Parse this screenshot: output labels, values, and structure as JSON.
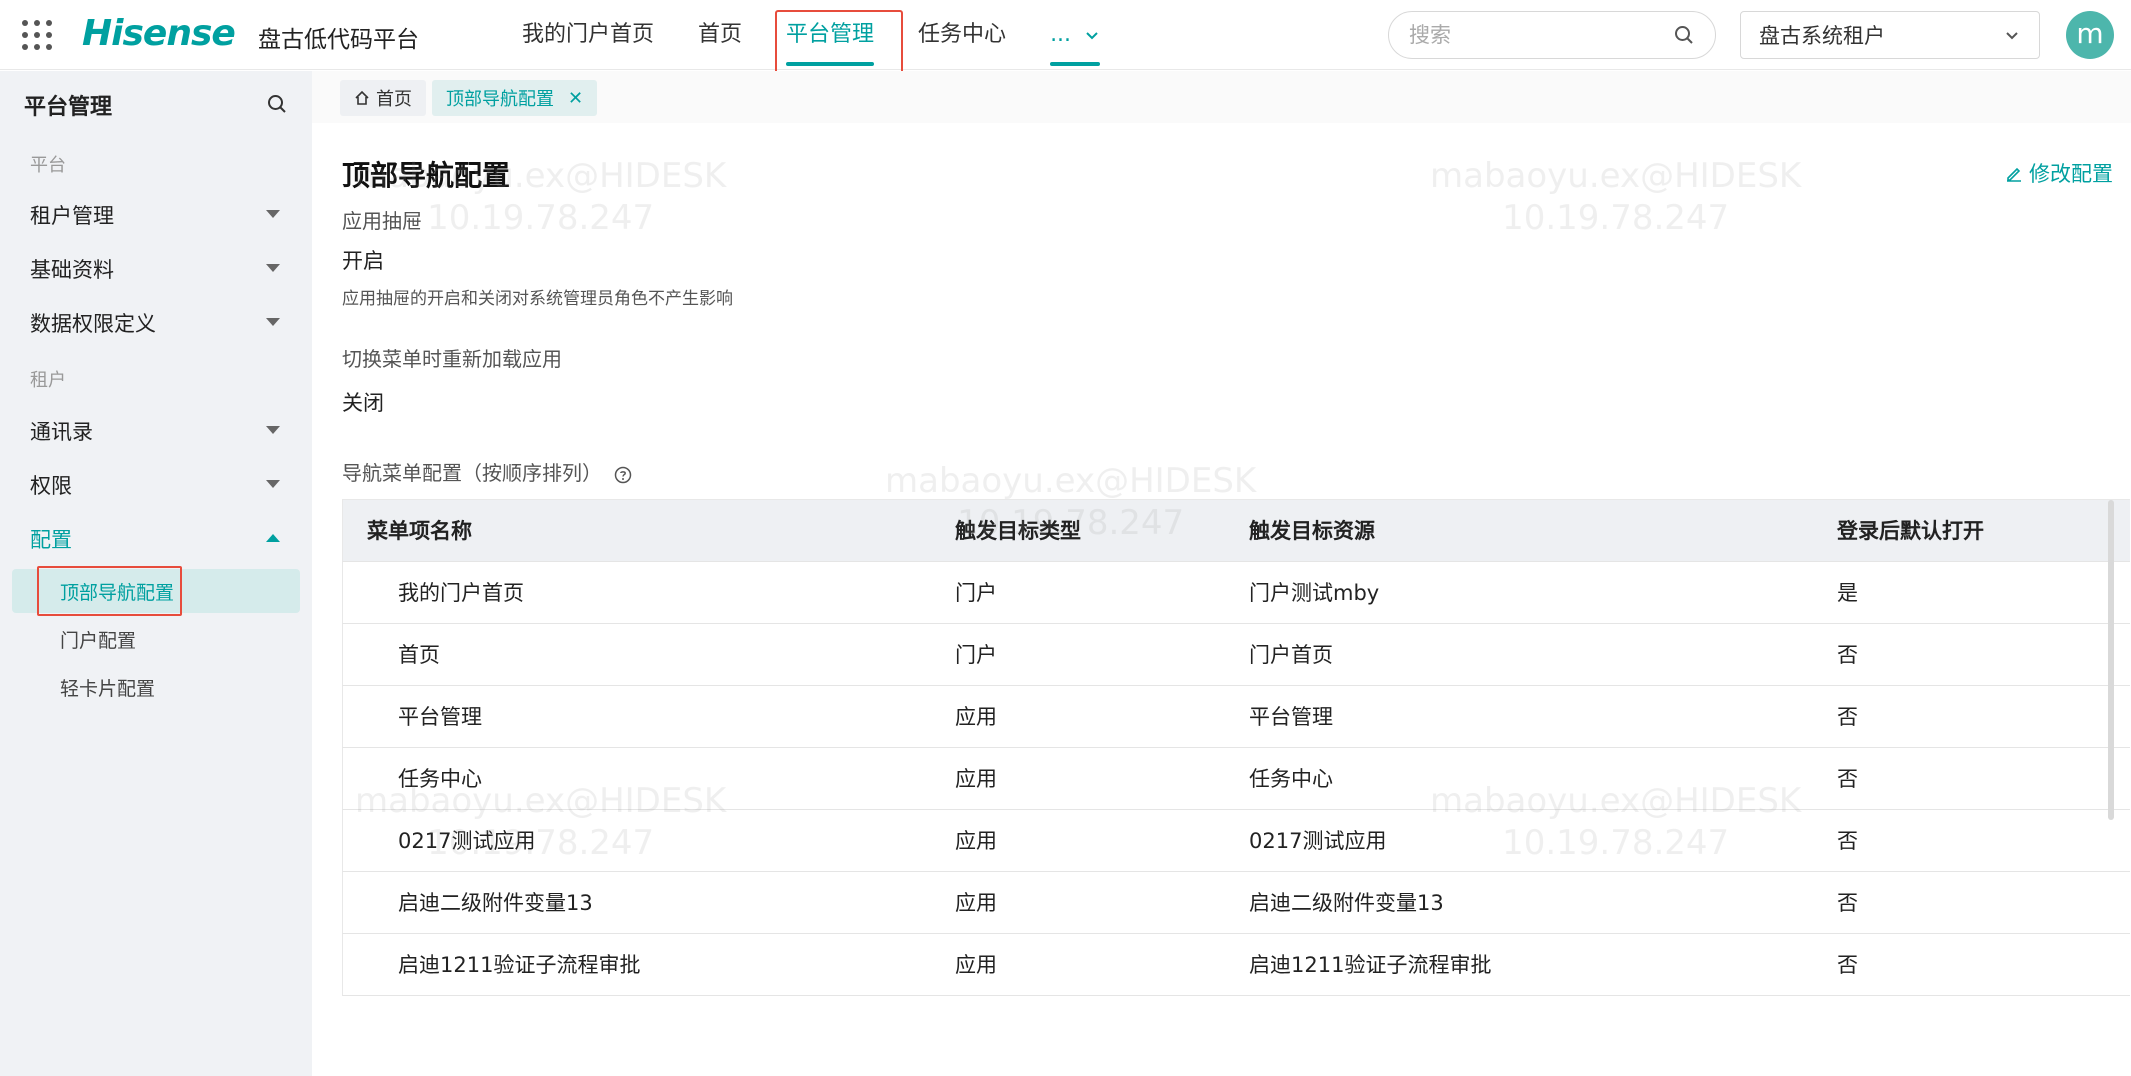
{
  "header": {
    "logo": "Hisense",
    "platform_name": "盘古低代码平台",
    "nav": [
      {
        "label": "我的门户首页"
      },
      {
        "label": "首页"
      },
      {
        "label": "平台管理"
      },
      {
        "label": "任务中心"
      },
      {
        "label": "..."
      }
    ],
    "search_placeholder": "搜索",
    "tenant": "盘古系统租户",
    "avatar_letter": "m"
  },
  "sidebar": {
    "title": "平台管理",
    "group_platform": "平台",
    "group_tenant": "租户",
    "items": {
      "tenant_mgmt": "租户管理",
      "basic_data": "基础资料",
      "data_perm": "数据权限定义",
      "contacts": "通讯录",
      "permission": "权限",
      "config": "配置"
    },
    "sub_items": {
      "top_nav": "顶部导航配置",
      "portal": "门户配置",
      "light_card": "轻卡片配置"
    }
  },
  "tabs": {
    "home": "首页",
    "current": "顶部导航配置",
    "close": "✕"
  },
  "page": {
    "title": "顶部导航配置",
    "edit_label": "修改配置",
    "drawer_label": "应用抽屉",
    "drawer_value": "开启",
    "drawer_hint": "应用抽屉的开启和关闭对系统管理员角色不产生影响",
    "reload_label": "切换菜单时重新加载应用",
    "reload_value": "关闭",
    "nav_config_label": "导航菜单配置（按顺序排列）"
  },
  "table": {
    "headers": [
      "菜单项名称",
      "触发目标类型",
      "触发目标资源",
      "登录后默认打开"
    ],
    "rows": [
      [
        "我的门户首页",
        "门户",
        "门户测试mby",
        "是"
      ],
      [
        "首页",
        "门户",
        "门户首页",
        "否"
      ],
      [
        "平台管理",
        "应用",
        "平台管理",
        "否"
      ],
      [
        "任务中心",
        "应用",
        "任务中心",
        "否"
      ],
      [
        "0217测试应用",
        "应用",
        "0217测试应用",
        "否"
      ],
      [
        "启迪二级附件变量13",
        "应用",
        "启迪二级附件变量13",
        "否"
      ],
      [
        "启迪1211验证子流程审批",
        "应用",
        "启迪1211验证子流程审批",
        "否"
      ]
    ]
  },
  "watermark": {
    "user": "mabaoyu.ex@HIDESK",
    "ip": "10.19.78.247"
  },
  "colors": {
    "accent": "#00a0a0",
    "highlight": "#e74c3c"
  }
}
